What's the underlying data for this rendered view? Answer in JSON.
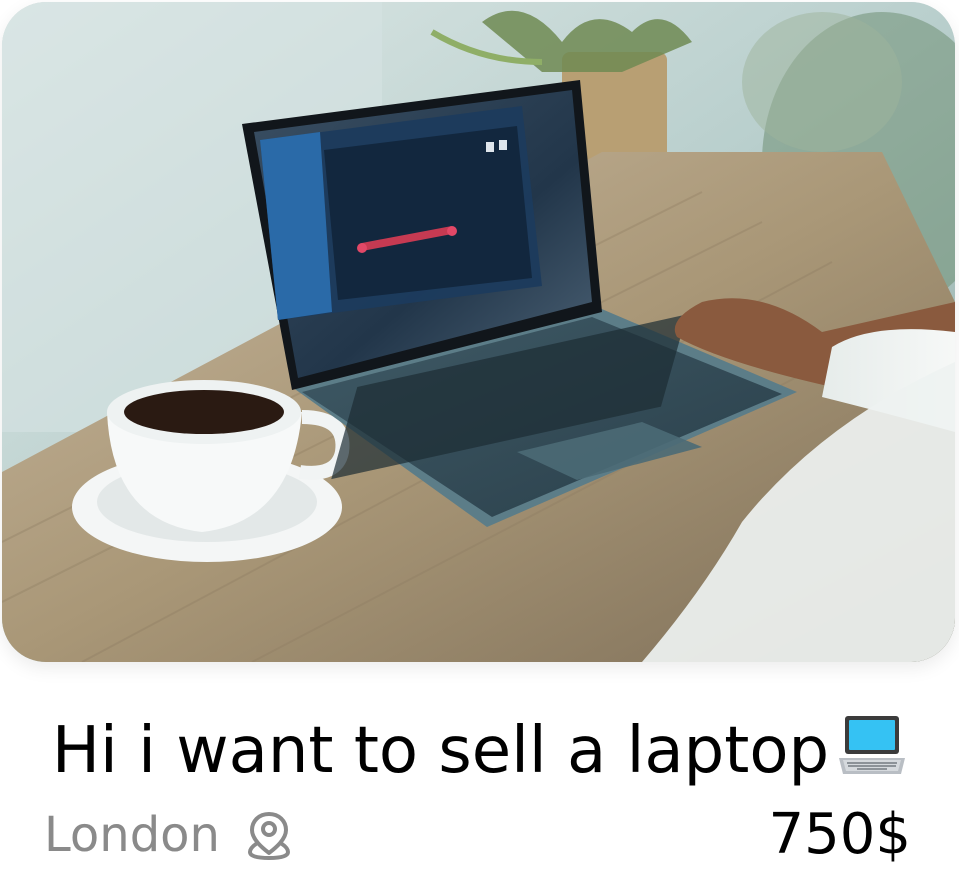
{
  "listing": {
    "title": "Hi i want to sell a laptop",
    "title_emoji_icon": "laptop-emoji-icon",
    "location": "London",
    "location_icon": "map-pin-icon",
    "price": "750$"
  },
  "colors": {
    "title": "#000000",
    "location": "#8a8a8a",
    "price": "#000000",
    "card_bg": "#ffffff"
  }
}
